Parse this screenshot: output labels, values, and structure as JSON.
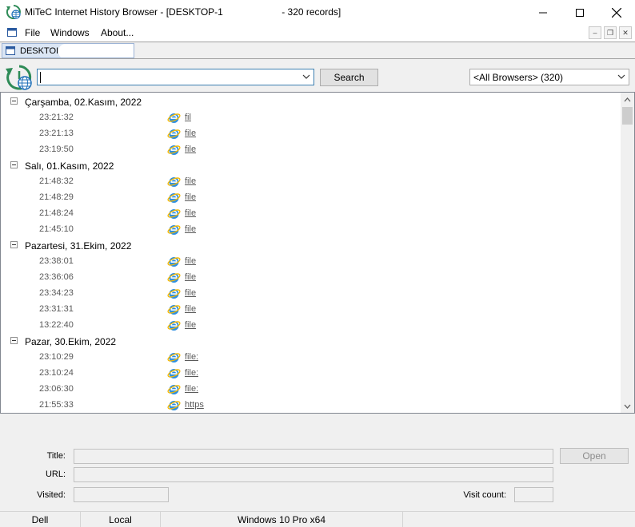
{
  "window": {
    "title": "MiTeC Internet History Browser - [DESKTOP-1                      - 320 records]"
  },
  "menu": {
    "items": [
      "File",
      "Windows",
      "About..."
    ]
  },
  "mdi_tab": {
    "label": "DESKTOI"
  },
  "toolbar": {
    "search_value": "",
    "search_button": "Search",
    "browser_filter": "<All Browsers> (320)"
  },
  "history": [
    {
      "date": "Çarşamba, 02.Kasım, 2022",
      "entries": [
        {
          "time": "23:21:32",
          "url": "fil"
        },
        {
          "time": "23:21:13",
          "url": "file"
        },
        {
          "time": "23:19:50",
          "url": "file"
        }
      ]
    },
    {
      "date": "Salı, 01.Kasım, 2022",
      "entries": [
        {
          "time": "21:48:32",
          "url": "file"
        },
        {
          "time": "21:48:29",
          "url": "file"
        },
        {
          "time": "21:48:24",
          "url": "file"
        },
        {
          "time": "21:45:10",
          "url": "file"
        }
      ]
    },
    {
      "date": "Pazartesi, 31.Ekim, 2022",
      "entries": [
        {
          "time": "23:38:01",
          "url": "file"
        },
        {
          "time": "23:36:06",
          "url": "file"
        },
        {
          "time": "23:34:23",
          "url": "file"
        },
        {
          "time": "23:31:31",
          "url": "file"
        },
        {
          "time": "13:22:40",
          "url": "file"
        }
      ]
    },
    {
      "date": "Pazar, 30.Ekim, 2022",
      "entries": [
        {
          "time": "23:10:29",
          "url": "file:"
        },
        {
          "time": "23:10:24",
          "url": "file:"
        },
        {
          "time": "23:06:30",
          "url": "file:"
        },
        {
          "time": "21:55:33",
          "url": "https"
        }
      ]
    }
  ],
  "details": {
    "title_label": "Title:",
    "url_label": "URL:",
    "visited_label": "Visited:",
    "visit_count_label": "Visit count:",
    "open_button": "Open"
  },
  "status": {
    "panes": [
      "Dell",
      "Local",
      "Windows 10 Pro x64"
    ]
  },
  "icons": {
    "app": "history-globe-icon",
    "entry": "internet-explorer-icon",
    "document": "document-window-icon"
  },
  "colors": {
    "accent": "#2e8b57",
    "ie_blue": "#1e90ff",
    "ie_ring": "#f5b800"
  }
}
